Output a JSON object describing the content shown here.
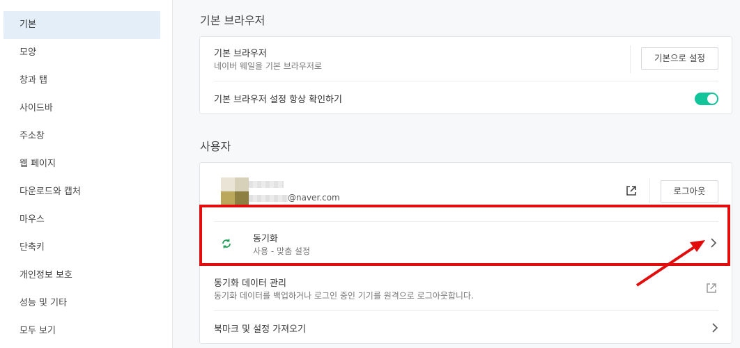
{
  "sidebar": {
    "items": [
      {
        "label": "기본",
        "active": true
      },
      {
        "label": "모양"
      },
      {
        "label": "창과 탭"
      },
      {
        "label": "사이드바"
      },
      {
        "label": "주소창"
      },
      {
        "label": "웹 페이지"
      },
      {
        "label": "다운로드와 캡처"
      },
      {
        "label": "마우스"
      },
      {
        "label": "단축키"
      },
      {
        "label": "개인정보 보호"
      },
      {
        "label": "성능 및 기타"
      },
      {
        "label": "모두 보기"
      }
    ]
  },
  "default_browser": {
    "section_title": "기본 브라우저",
    "row_title": "기본 브라우저",
    "row_subtitle": "네이버 웨일을 기본 브라우저로",
    "button_label": "기본으로 설정",
    "check_label": "기본 브라우저 설정 항상 확인하기",
    "check_enabled": true
  },
  "user": {
    "section_title": "사용자",
    "email_domain": "@naver.com",
    "logout_label": "로그아웃",
    "sync_title": "동기화",
    "sync_subtitle": "사용 - 맞춤 설정",
    "sync_data_title": "동기화 데이터 관리",
    "sync_data_subtitle": "동기화 데이터를 백업하거나 로그인 중인 기기를 원격으로 로그아웃합니다.",
    "import_label": "북마크 및 설정 가져오기"
  },
  "colors": {
    "accent_green": "#12c49a",
    "highlight_red": "#e20c0c",
    "sidebar_active": "#e3eef9"
  }
}
